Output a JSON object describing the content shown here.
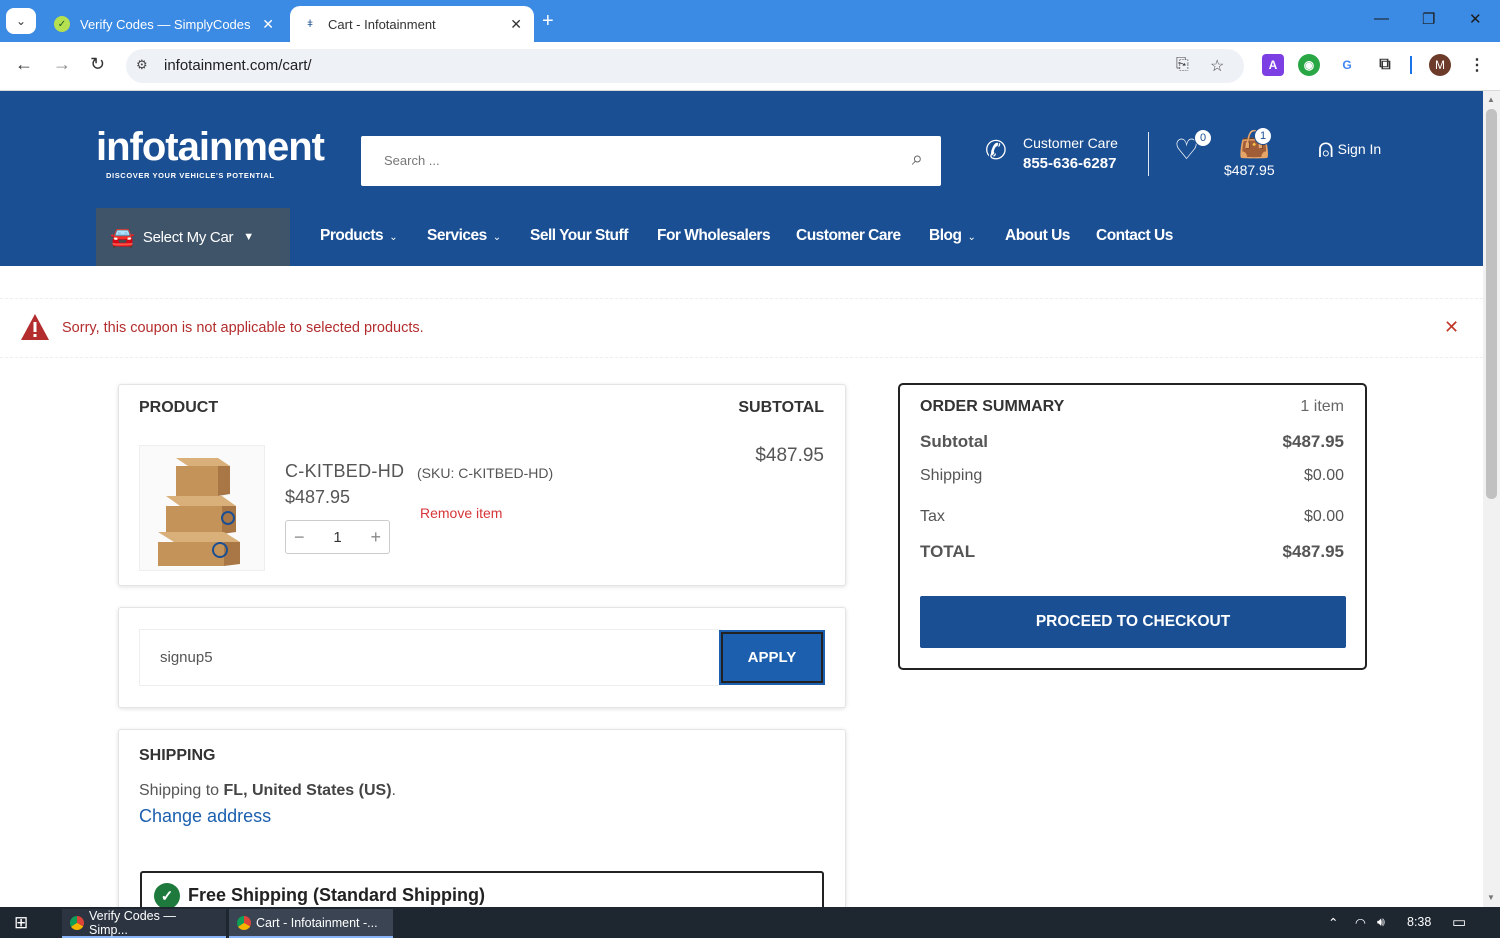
{
  "browser": {
    "tabs": [
      {
        "title": "Verify Codes — SimplyCodes",
        "active": false
      },
      {
        "title": "Cart - Infotainment",
        "active": true
      }
    ],
    "url": "infotainment.com/cart/",
    "profile_initial": "M",
    "ext_a": "A"
  },
  "header": {
    "logo_text": "infotainment",
    "logo_tagline": "DISCOVER YOUR VEHICLE'S POTENTIAL",
    "search_placeholder": "Search ...",
    "care_label": "Customer Care",
    "care_phone": "855-636-6287",
    "wishlist_count": "0",
    "cart_count": "1",
    "cart_total": "$487.95",
    "signin": "Sign In"
  },
  "nav": {
    "select_car": "Select My Car",
    "items": [
      {
        "label": "Products"
      },
      {
        "label": "Services"
      },
      {
        "label": "Sell Your Stuff"
      },
      {
        "label": "For Wholesalers"
      },
      {
        "label": "Customer Care"
      },
      {
        "label": "Blog"
      },
      {
        "label": "About Us"
      },
      {
        "label": "Contact Us"
      }
    ]
  },
  "notice": {
    "message": "Sorry, this coupon is not applicable to selected products."
  },
  "cart": {
    "header_product": "PRODUCT",
    "header_subtotal": "SUBTOTAL",
    "item": {
      "name": "C-KITBED-HD",
      "sku": "(SKU: C-KITBED-HD)",
      "price": "$487.95",
      "remove": "Remove item",
      "quantity": "1",
      "subtotal": "$487.95"
    },
    "coupon_value": "signup5",
    "apply_label": "APPLY",
    "shipping": {
      "title": "SHIPPING",
      "prefix": "Shipping to ",
      "destination": "FL, United States (US)",
      "suffix": ".",
      "change": "Change address",
      "option": "Free Shipping (Standard Shipping)"
    }
  },
  "summary": {
    "title": "ORDER SUMMARY",
    "count": "1 item",
    "subtotal_label": "Subtotal",
    "subtotal": "$487.95",
    "shipping_label": "Shipping",
    "shipping": "$0.00",
    "tax_label": "Tax",
    "tax": "$0.00",
    "total_label": "TOTAL",
    "total": "$487.95",
    "checkout": "PROCEED TO CHECKOUT"
  },
  "taskbar": {
    "apps": [
      {
        "title": "Verify Codes — Simp..."
      },
      {
        "title": "Cart - Infotainment -..."
      }
    ],
    "time": "8:38"
  },
  "colors": {
    "brand": "#1b4f93",
    "chrome_blue": "#3b8ae3",
    "error": "#b32d2e"
  }
}
